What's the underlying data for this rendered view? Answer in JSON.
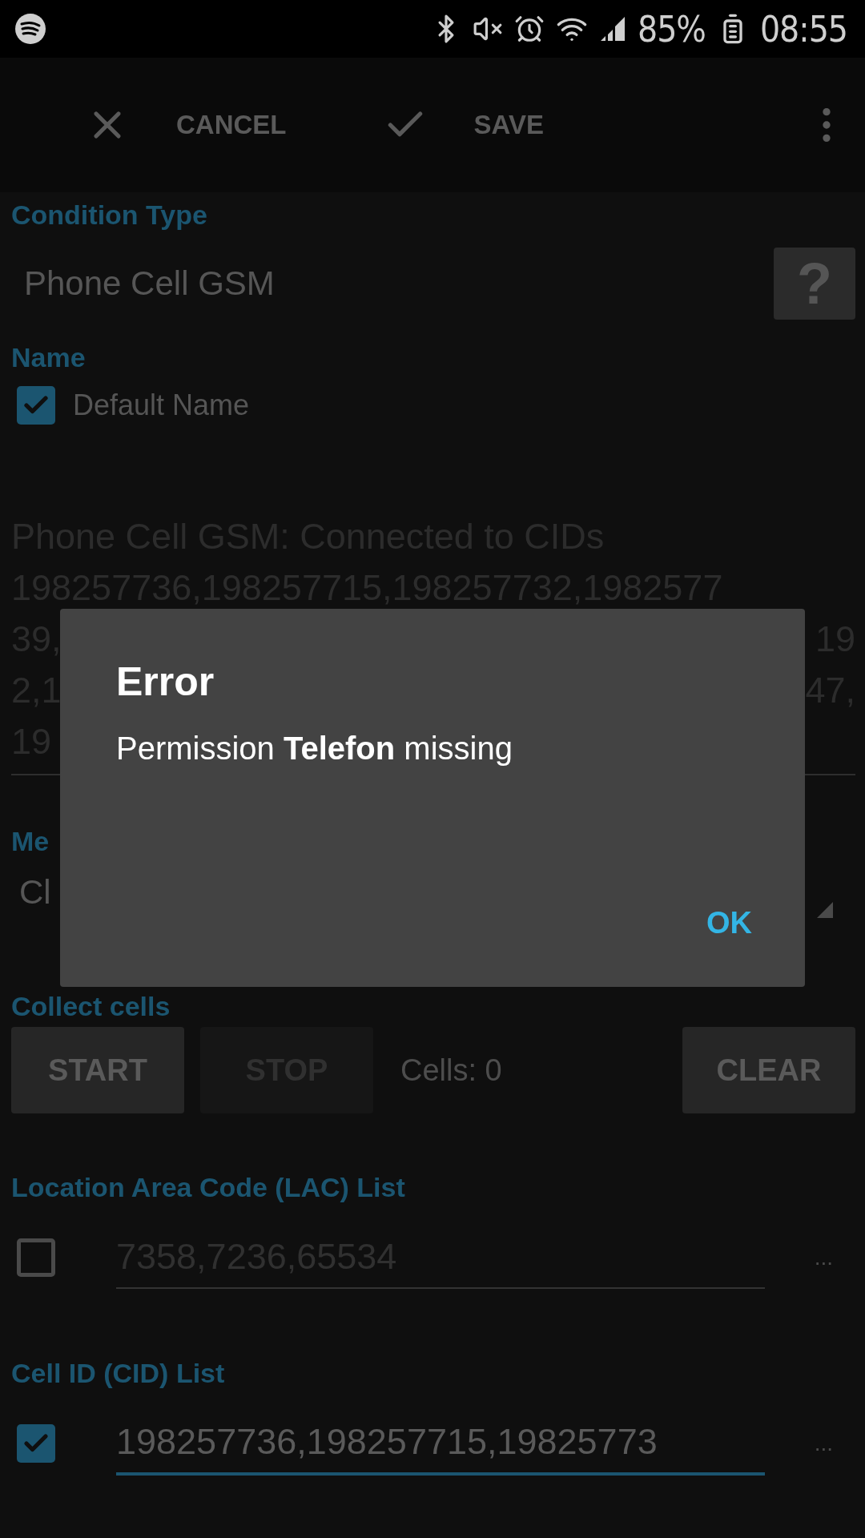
{
  "status_bar": {
    "battery": "85%",
    "time": "08:55"
  },
  "toolbar": {
    "actions": [
      {
        "kind": "cancel",
        "label": "CANCEL"
      },
      {
        "kind": "save",
        "label": "SAVE"
      }
    ]
  },
  "condition_type": {
    "label": "Condition Type",
    "value": "Phone Cell GSM",
    "help": "?"
  },
  "name": {
    "label": "Name",
    "default_name": {
      "label": "Default Name",
      "checked": true
    },
    "text_lines": [
      [
        "Phone Cell GSM: Connected to CIDs"
      ],
      [
        "198257736,198257715,198257732,1982577"
      ],
      [
        "39,",
        "19"
      ],
      [
        "2,1",
        "47,"
      ],
      [
        "19"
      ]
    ]
  },
  "method": {
    "label": "Me",
    "value": "Cl"
  },
  "collect_cells": {
    "label": "Collect cells",
    "buttons": [
      {
        "label": "START",
        "disabled": false
      },
      {
        "label": "STOP",
        "disabled": true
      }
    ],
    "count": "Cells: 0",
    "clear": "CLEAR"
  },
  "lac_list": {
    "label": "Location Area Code (LAC) List",
    "checked": false,
    "placeholder": "7358,7236,65534",
    "focused": false,
    "more": "..."
  },
  "cid_list": {
    "label": "Cell ID (CID) List",
    "checked": true,
    "value": "198257736,198257715,19825773",
    "focused": true,
    "more": "..."
  },
  "dialog": {
    "title": "Error",
    "message": "Permission **Telefon** missing",
    "button": "OK"
  }
}
